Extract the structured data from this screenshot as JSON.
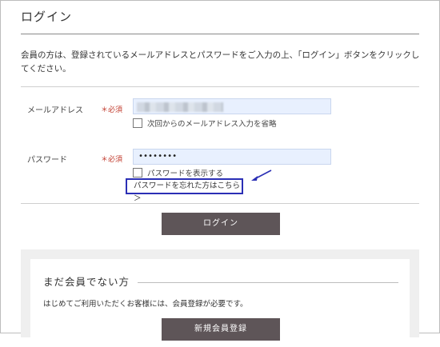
{
  "page": {
    "title": "ログイン",
    "intro": "会員の方は、登録されているメールアドレスとパスワードをご入力の上、「ログイン」ボタンをクリックしてください。"
  },
  "email": {
    "label": "メールアドレス",
    "required": "＊必須",
    "value": "",
    "save_checkbox": "次回からのメールアドレス入力を省略"
  },
  "password": {
    "label": "パスワード",
    "required": "＊必須",
    "value": "••••••••",
    "show_checkbox": "パスワードを表示する",
    "forgot_link": "パスワードを忘れた方はこちら ＞"
  },
  "login_button": "ログイン",
  "register": {
    "title": "まだ会員でない方",
    "text": "はじめてご利用いただくお客様には、会員登録が必要です。",
    "button": "新規会員登録"
  },
  "colors": {
    "button": "#5e5558",
    "input_bg": "#e8f0fe",
    "required": "#c0392b",
    "highlight": "#2b2fb5"
  }
}
